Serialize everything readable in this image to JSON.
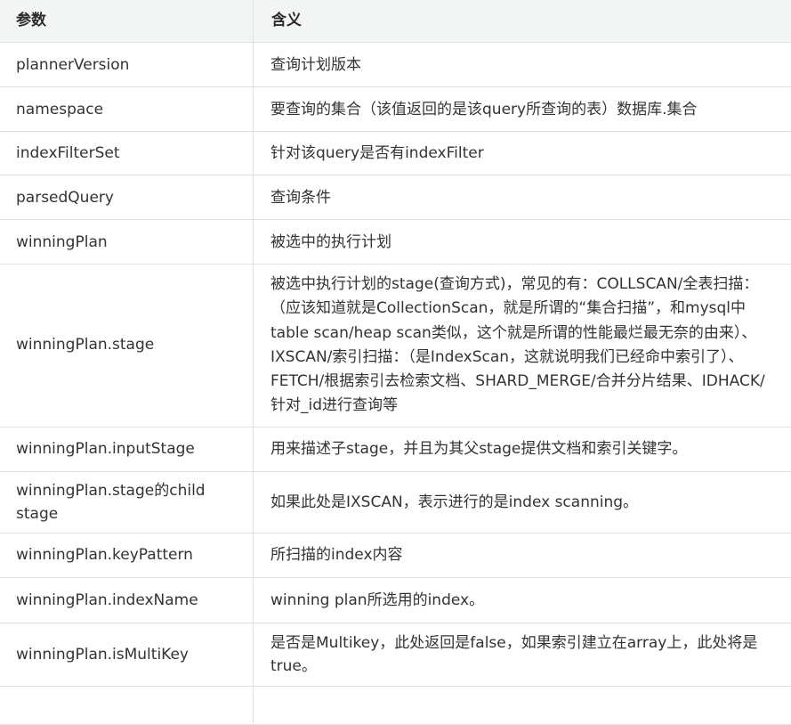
{
  "table": {
    "headers": {
      "param": "参数",
      "meaning": "含义"
    },
    "rows": [
      {
        "param": "plannerVersion",
        "meaning": "查询计划版本"
      },
      {
        "param": "namespace",
        "meaning": "要查询的集合（该值返回的是该query所查询的表）数据库.集合"
      },
      {
        "param": "indexFilterSet",
        "meaning": "针对该query是否有indexFilter"
      },
      {
        "param": "parsedQuery",
        "meaning": "查询条件"
      },
      {
        "param": "winningPlan",
        "meaning": "被选中的执行计划"
      },
      {
        "param": "winningPlan.stage",
        "meaning": "被选中执行计划的stage(查询方式)，常见的有：COLLSCAN/全表扫描：（应该知道就是CollectionScan，就是所谓的“集合扫描”，和mysql中table scan/heap scan类似，这个就是所谓的性能最烂最无奈的由来）、IXSCAN/索引扫描：（是IndexScan，这就说明我们已经命中索引了）、FETCH/根据索引去检索文档、SHARD_MERGE/合并分片结果、IDHACK/针对_id进行查询等"
      },
      {
        "param": "winningPlan.inputStage",
        "meaning": "用来描述子stage，并且为其父stage提供文档和索引关键字。"
      },
      {
        "param": "winningPlan.stage的child stage",
        "meaning": "如果此处是IXSCAN，表示进行的是index scanning。"
      },
      {
        "param": "winningPlan.keyPattern",
        "meaning": "所扫描的index内容"
      },
      {
        "param": "winningPlan.indexName",
        "meaning": "winning plan所选用的index。"
      },
      {
        "param": "winningPlan.isMultiKey",
        "meaning": "是否是Multikey，此处返回是false，如果索引建立在array上，此处将是true。"
      }
    ]
  }
}
